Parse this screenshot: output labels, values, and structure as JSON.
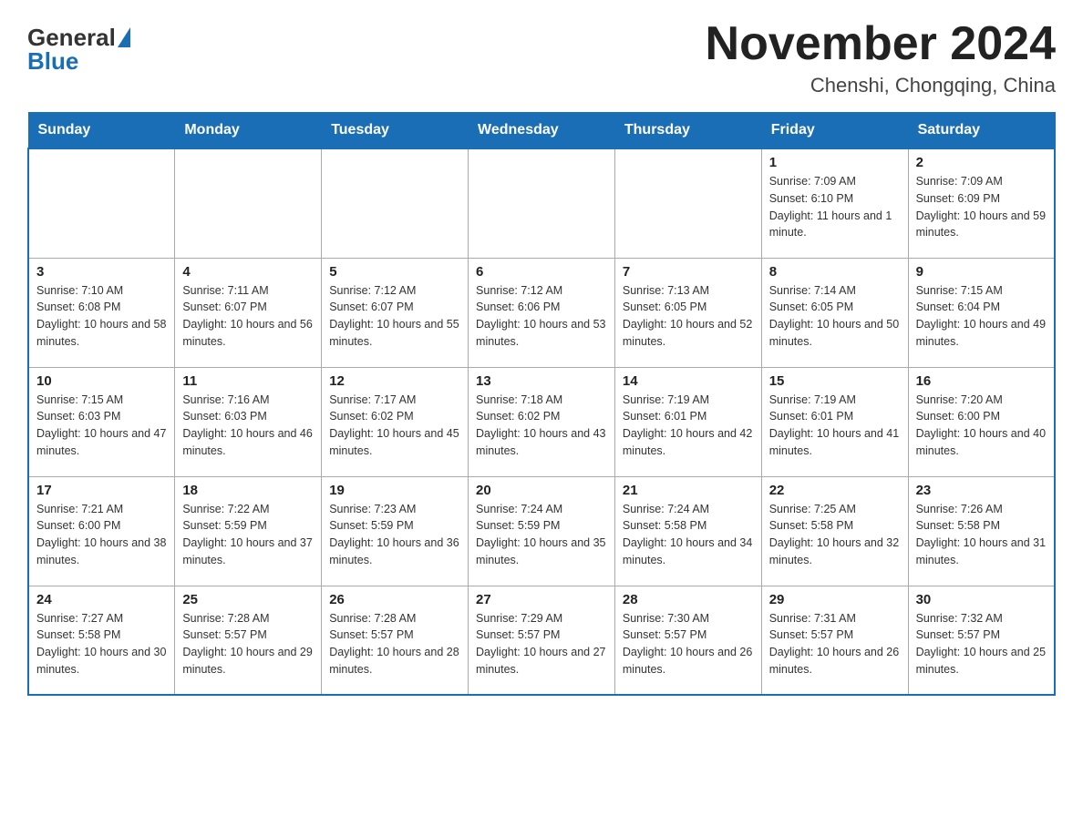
{
  "header": {
    "logo_general": "General",
    "logo_blue": "Blue",
    "title": "November 2024",
    "subtitle": "Chenshi, Chongqing, China"
  },
  "weekdays": [
    "Sunday",
    "Monday",
    "Tuesday",
    "Wednesday",
    "Thursday",
    "Friday",
    "Saturday"
  ],
  "weeks": [
    [
      {
        "day": "",
        "empty": true
      },
      {
        "day": "",
        "empty": true
      },
      {
        "day": "",
        "empty": true
      },
      {
        "day": "",
        "empty": true
      },
      {
        "day": "",
        "empty": true
      },
      {
        "day": "1",
        "sunrise": "7:09 AM",
        "sunset": "6:10 PM",
        "daylight": "11 hours and 1 minute."
      },
      {
        "day": "2",
        "sunrise": "7:09 AM",
        "sunset": "6:09 PM",
        "daylight": "10 hours and 59 minutes."
      }
    ],
    [
      {
        "day": "3",
        "sunrise": "7:10 AM",
        "sunset": "6:08 PM",
        "daylight": "10 hours and 58 minutes."
      },
      {
        "day": "4",
        "sunrise": "7:11 AM",
        "sunset": "6:07 PM",
        "daylight": "10 hours and 56 minutes."
      },
      {
        "day": "5",
        "sunrise": "7:12 AM",
        "sunset": "6:07 PM",
        "daylight": "10 hours and 55 minutes."
      },
      {
        "day": "6",
        "sunrise": "7:12 AM",
        "sunset": "6:06 PM",
        "daylight": "10 hours and 53 minutes."
      },
      {
        "day": "7",
        "sunrise": "7:13 AM",
        "sunset": "6:05 PM",
        "daylight": "10 hours and 52 minutes."
      },
      {
        "day": "8",
        "sunrise": "7:14 AM",
        "sunset": "6:05 PM",
        "daylight": "10 hours and 50 minutes."
      },
      {
        "day": "9",
        "sunrise": "7:15 AM",
        "sunset": "6:04 PM",
        "daylight": "10 hours and 49 minutes."
      }
    ],
    [
      {
        "day": "10",
        "sunrise": "7:15 AM",
        "sunset": "6:03 PM",
        "daylight": "10 hours and 47 minutes."
      },
      {
        "day": "11",
        "sunrise": "7:16 AM",
        "sunset": "6:03 PM",
        "daylight": "10 hours and 46 minutes."
      },
      {
        "day": "12",
        "sunrise": "7:17 AM",
        "sunset": "6:02 PM",
        "daylight": "10 hours and 45 minutes."
      },
      {
        "day": "13",
        "sunrise": "7:18 AM",
        "sunset": "6:02 PM",
        "daylight": "10 hours and 43 minutes."
      },
      {
        "day": "14",
        "sunrise": "7:19 AM",
        "sunset": "6:01 PM",
        "daylight": "10 hours and 42 minutes."
      },
      {
        "day": "15",
        "sunrise": "7:19 AM",
        "sunset": "6:01 PM",
        "daylight": "10 hours and 41 minutes."
      },
      {
        "day": "16",
        "sunrise": "7:20 AM",
        "sunset": "6:00 PM",
        "daylight": "10 hours and 40 minutes."
      }
    ],
    [
      {
        "day": "17",
        "sunrise": "7:21 AM",
        "sunset": "6:00 PM",
        "daylight": "10 hours and 38 minutes."
      },
      {
        "day": "18",
        "sunrise": "7:22 AM",
        "sunset": "5:59 PM",
        "daylight": "10 hours and 37 minutes."
      },
      {
        "day": "19",
        "sunrise": "7:23 AM",
        "sunset": "5:59 PM",
        "daylight": "10 hours and 36 minutes."
      },
      {
        "day": "20",
        "sunrise": "7:24 AM",
        "sunset": "5:59 PM",
        "daylight": "10 hours and 35 minutes."
      },
      {
        "day": "21",
        "sunrise": "7:24 AM",
        "sunset": "5:58 PM",
        "daylight": "10 hours and 34 minutes."
      },
      {
        "day": "22",
        "sunrise": "7:25 AM",
        "sunset": "5:58 PM",
        "daylight": "10 hours and 32 minutes."
      },
      {
        "day": "23",
        "sunrise": "7:26 AM",
        "sunset": "5:58 PM",
        "daylight": "10 hours and 31 minutes."
      }
    ],
    [
      {
        "day": "24",
        "sunrise": "7:27 AM",
        "sunset": "5:58 PM",
        "daylight": "10 hours and 30 minutes."
      },
      {
        "day": "25",
        "sunrise": "7:28 AM",
        "sunset": "5:57 PM",
        "daylight": "10 hours and 29 minutes."
      },
      {
        "day": "26",
        "sunrise": "7:28 AM",
        "sunset": "5:57 PM",
        "daylight": "10 hours and 28 minutes."
      },
      {
        "day": "27",
        "sunrise": "7:29 AM",
        "sunset": "5:57 PM",
        "daylight": "10 hours and 27 minutes."
      },
      {
        "day": "28",
        "sunrise": "7:30 AM",
        "sunset": "5:57 PM",
        "daylight": "10 hours and 26 minutes."
      },
      {
        "day": "29",
        "sunrise": "7:31 AM",
        "sunset": "5:57 PM",
        "daylight": "10 hours and 26 minutes."
      },
      {
        "day": "30",
        "sunrise": "7:32 AM",
        "sunset": "5:57 PM",
        "daylight": "10 hours and 25 minutes."
      }
    ]
  ]
}
